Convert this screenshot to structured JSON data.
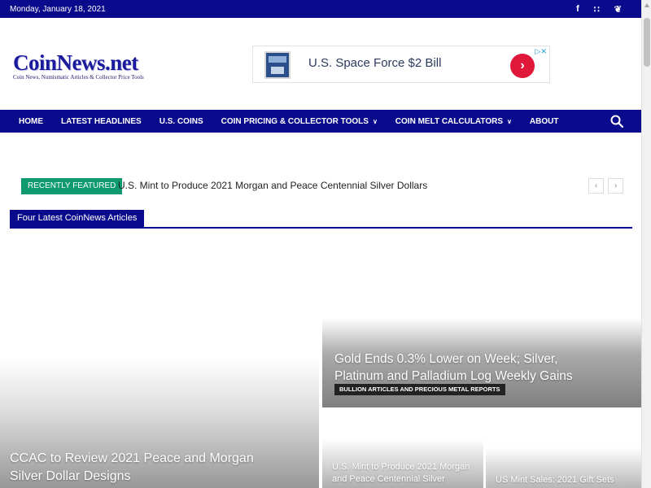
{
  "topbar": {
    "date": "Monday, January 18, 2021",
    "social": [
      {
        "icon": "facebook-icon",
        "glyph": "f"
      },
      {
        "icon": "rss-icon",
        "glyph": "∷"
      },
      {
        "icon": "twitter-icon",
        "glyph": "❦"
      }
    ]
  },
  "header": {
    "logo_name": "CoinNews.net",
    "logo_tagline": "Coin News, Numismatic Articles & Collector Price Tools"
  },
  "ad": {
    "text": "U.S. Space Force $2 Bill",
    "go_glyph": "›",
    "adchoices_glyph": "▷✕"
  },
  "nav": {
    "items": [
      {
        "label": "HOME",
        "dropdown": false
      },
      {
        "label": "LATEST HEADLINES",
        "dropdown": false
      },
      {
        "label": "U.S. COINS",
        "dropdown": false
      },
      {
        "label": "COIN PRICING & COLLECTOR TOOLS",
        "dropdown": true
      },
      {
        "label": "COIN MELT CALCULATORS",
        "dropdown": true
      },
      {
        "label": "ABOUT",
        "dropdown": false
      }
    ],
    "caret": "∨"
  },
  "ticker": {
    "badge": "RECENTLY FEATURED",
    "headline": "U.S. Mint to Produce 2021 Morgan and Peace Centennial Silver Dollars",
    "prev": "‹",
    "next": "›"
  },
  "block": {
    "title": "Four Latest CoinNews Articles"
  },
  "articles": [
    {
      "title": "CCAC to Review 2021 Peace and Morgan Silver Dollar Designs"
    },
    {
      "title": "Gold Ends 0.3% Lower on Week; Silver, Platinum and Palladium Log Weekly Gains",
      "category": "BULLION ARTICLES AND PRECIOUS METAL REPORTS"
    },
    {
      "title": "U.S. Mint to Produce 2021 Morgan and Peace Centennial Silver"
    },
    {
      "title": "US Mint Sales: 2021 Gift Sets"
    }
  ],
  "colors": {
    "brand_navy": "#0a0a8c",
    "badge_green": "#0d9a6e",
    "ad_red": "#e0193a"
  }
}
